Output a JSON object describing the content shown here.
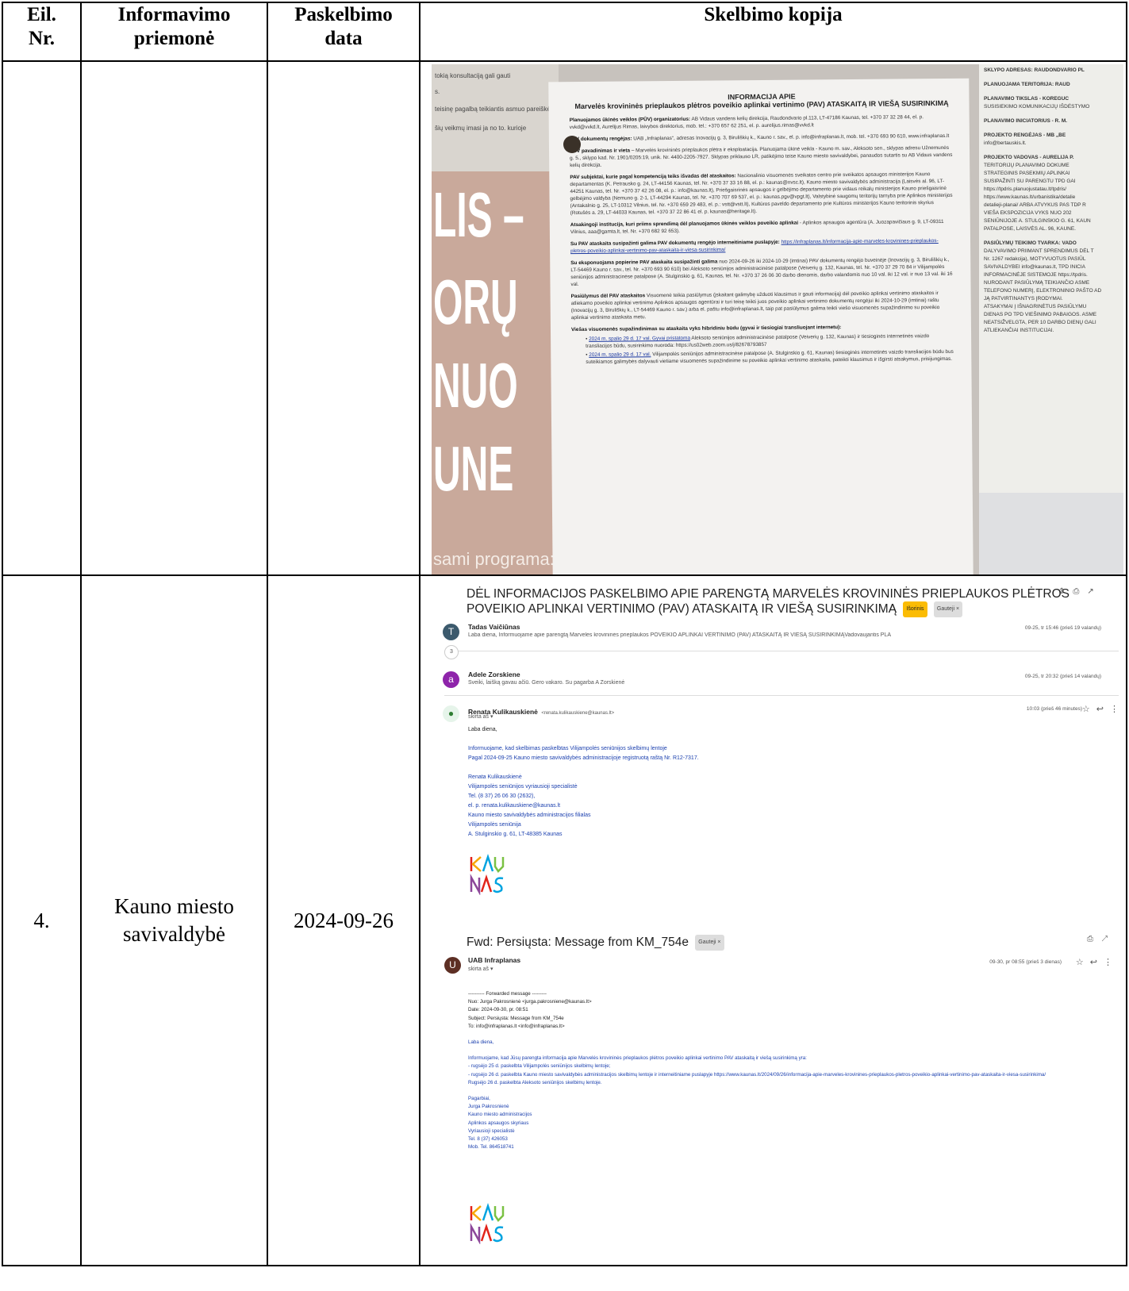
{
  "table": {
    "headers": {
      "col1": [
        "Eil.",
        "Nr."
      ],
      "col2": [
        "Informavimo",
        "priemonė"
      ],
      "col3": [
        "Paskelbimo",
        "data"
      ],
      "col4": "Skelbimo kopija"
    },
    "row2": {
      "nr": "4.",
      "medium": [
        "Kauno miesto",
        "savivaldybė"
      ],
      "date": "2024-09-26"
    }
  },
  "photo": {
    "left_lines": [
      "tokią konsultaciją gali gauti",
      "s.",
      "teisinę pagalbą teikiantis asmuo pareiškėj",
      "šių veikmų imasi ja no to. kurioje"
    ],
    "big": [
      "LIS –",
      "ORŲ",
      "NUO",
      "UNE"
    ],
    "bottom_word": "sami programa:",
    "title1": "INFORMACIJA APIE",
    "title2": "Marvelės krovininės prieplaukos plėtros poveikio aplinkai vertinimo (PAV) ATASKAITĄ IR VIEŠĄ SUSIRINKIMĄ",
    "p1_label": "Planuojamos ūkinės veiklos (PŪV) organizatorius:",
    "p1": " AB Vidaus vandens kelių direkcija, Raudondvario pl.113, LT-47186 Kaunas, tel. +370 37 32 28 44, el. p. vvkd@vvkd.lt, Aurelijus Rimas, laivybos direktorius, mob. tel.: +370 657 62 251, el. p. aurelijus.rimas@vvkd.lt",
    "p2_label": "PAV dokumentų rengėjas:",
    "p2": " UAB „Infraplanas“, adresas Inovacijų g. 3, Biruliškių k., Kauno r. sav., el. p. info@infraplanas.lt, mob. tel. +370 693 90 610, www.infraplanas.lt",
    "p3_label": "PŪV pavadinimas ir vieta",
    "p3": " – Marvelės krovininės prieplaukos plėtra ir eksploatacija. Planuojama ūkinė veikla - Kauno m. sav., Aleksoto sen., sklypas adresu Užnemunės g. 5., sklypo kad. Nr. 1901/0205:19, unik. Nr. 4400-2205-7927. Sklypas priklauso LR, patikėjimo teise Kauno miesto savivaldybei, panaudos sutartis su AB Vidaus vandens kelių direkcija.",
    "p4_label": "PAV subjektai, kurie pagal kompetenciją teiks išvadas dėl ataskaitos:",
    "p4": " Nacionalinio visuomenės sveikatos centro prie sveikatos apsaugos ministerijos Kauno departamentas (K. Petrausko g. 24, LT-44156 Kaunas, tel. Nr. +370 37 33 16 88, el. p.: kaunas@nvsc.lt), Kauno miesto savivaldybės administracija (Laisvės al. 96, LT-44251 Kaunas, tel. Nr. +370 37 42 26 08, el. p.: info@kaunas.lt), Priešgaisrinės apsaugos ir gelbėjimo departamento prie vidaus reikalų ministerijos Kauno priešgaisrinė gelbėjimo valdyba (Nemuno g. 2-1, LT-44294 Kaunas, tel. Nr. +370 707 69 537, el. p.: kaunas.pgv@vpgt.lt), Valstybinė saugomų teritorijų tarnyba prie Aplinkos ministerijos (Antakalnio g. 25, LT-10312 Vilnius, tel. Nr. +370 659 29 483, el. p.: vstt@vstt.lt), Kultūros paveldo departamento prie Kultūros ministerijos Kauno teritorinis skyrius (Rotušės a. 29, LT-44033 Kaunas, tel. +370 37 22 86 41 el. p. kaunas@heritage.lt).",
    "p5_label": "Atsakingoji institucija, kuri priims sprendimą dėl planuojamos ūkinės veiklos poveikio aplinkai",
    "p5": " - Aplinkos apsaugos agentūra (A. Juozapavičiaus g. 9, LT-09311 Vilnius, aaa@gamta.lt, tel. Nr. +370 682 92 653).",
    "p6_label": "Su PAV ataskaita susipažinti galima PAV dokumentų rengėjo interneitiniame puslapyje:",
    "p6_link": "https://infraplanas.lt/informacija-apie-marveles-krovinines-prieplaukos-pletros-poveikio-aplinkai-vertinimo-pav-ataskaita-ir-viesa-susirinkima/",
    "p7_label": "Su eksponuojama popierine PAV ataskaita susipažinti galima",
    "p7": " nuo 2024-09-26 iki 2024-10-29 (imtinai) PAV dokumentų rengėjo buveinėje (Inovacijų g. 3, Biruliškių k., LT-54469 Kauno r. sav., tel. Nr. +370 693 90 610) bei Aleksoto seniūnijos administracinėse patalpose (Veiverių g. 132, Kaunas, tel. Nr. +370 37 29 70 84 ir Vilijampolės seniūnijos administracinėse patalpose (A. Stulginskio g. 61, Kaunas, tel. Nr. +370 37 26 06 30 darbo dienomis, darbo valandomis nuo 10 val. iki 12 val. ir nuo 13 val. iki 16 val.",
    "p8_label": "Pasiūlymus dėl PAV ataskaitos",
    "p8": " Visuomenė teikia pasiūlymus (įskaitant galimybę užduoti klausimus ir gauti informaciją) dėl poveikio aplinkai vertinimo ataskaitos ir atliekamo poveikio aplinkai vertinimo Aplinkos apsaugos agentūrai ir turi teisę teikti juos poveikio aplinkai vertinimo dokumentų rengėjui iki 2024-10-29 (imtinai) raštu (Inovacijų g. 3, Biruliškių k., LT-54469 Kauno r. sav.) arba el. paštu info@infraplanas.lt, taip pat pasiūlymus galima teikti viešo visuomenės supažindinimo su poveikio aplinkai vertinimo ataskaita metu.",
    "p9_label": "Viešas visuomenės supažindinimas su ataskaita vyks hibridiniu būdu (gyvai ir tiesiogiai transliuojant internetu):",
    "b1_date": "2024 m. spalio 29 d. 17 val. Gyvai pristatoma",
    "b1": " Aleksoto seniūnijos administracinėse patalpose (Veiverių g. 132, Kaunas) ir tiesioginės internetinės vaizdo transliacijos būdu, susirinkimo nuoroda: https://us02web.zoom.us/j/82678793857",
    "b2_date": "2024 m. spalio 29 d. 17 val.",
    "b2": " Vilijampolės seniūnijos administracinėse patalpose (A. Stulginskio g. 61, Kaunas) tiesioginės internetinės vaizdo transliacijos būdu bus suteikiamos galimybės dalyvauti vietiame visuomenės supažindinime su poveikio aplinkai vertinimo ataskaita, pateikti klausimus ir išgirsti atsakymus, prisijungimas.",
    "right": [
      "SKLYPO ADRESAS: RAUDONDVARIO PL",
      "PLANUOJAMA TERITORIJA: RAUD",
      "PLANAVIMO TIKSLAS - KOREGUC",
      "SUSISIEKIMO KOMUNIKACIJŲ IŠDĖSTYMO",
      "PLANAVIMO INICIATORIUS - R. M.",
      "PROJEKTO RENGĖJAS - MB „BE",
      "info@bertauskis.lt.",
      "PROJEKTO VADOVAS - AURELIJA P.",
      "TERITORIJŲ PLANAVIMO DOKUME",
      "STRATEGINIS PASEKMIŲ APLINKAI",
      "SUSIPAŽINTI SU PARENGTU TPD GAI",
      "https://tpdris.planuojustatau.lt/tpdris/",
      "https://www.kaunas.lt/urbanistika/detalie",
      "detalieji-planai/ ARBA ATVYKUS PAS TDP R",
      "VIEŠA EKSPOZICIJA VYKS NUO 202",
      "SENIŪNIJOJE A. STULGINSKIO G. 61, KAUN",
      "PATALPOSE, LAISVĖS AL. 96, KAUNE.",
      "PASIŪLYMŲ TEIKIMO TVARKA: VADO",
      "DALYVAVIMO PRIIMANT SPRENDIMUS DĖL T",
      "Nr. 1267 redakcija), MOTYVUOTUS PASIŪL",
      "SAVIVALDYBEI info@kaunas.lt, TPD INICIA",
      "INFORMACINĖJE SISTEMOJE https://tpdris.",
      "NURODANT PASIŪLYMĄ TEIKIANČIO ASME",
      "TELEFONO NUMERĮ, ELEKTRONINIO PAŠTO AD",
      "JĄ PATVIRTINANTYS ĮRODYMAI.",
      "ATSAKYMAI Į IŠNAGRINĖTUS PASIŪLYMU",
      "DIENAS PO TPD VIEŠINIMO PABAIGOS. ASME",
      "NEATSIŽVELGTA, PER 10 DARBO DIENŲ GALI",
      "ATLIEKANČIAI INSTITUCIJAI."
    ]
  },
  "email1": {
    "subject": "DĖL INFORMACIJOS PASKELBIMO APIE PARENGTĄ MARVELĖS KROVININĖS PRIEPLAUKOS PLĖTROS POVEIKIO APLINKAI VERTINIMO (PAV) ATASKAITĄ IR VIEŠĄ SUSIRINKIMĄ",
    "tag1": "Išorinis",
    "tag2": "Gauteji ×",
    "m1_initial": "T",
    "m1_name": "Tadas Vaičiūnas",
    "m1_snippet": "Laba diena, Informuojame apie parengtą Marvelės krovininės prieplaukos POVEIKIO APLINKAI VERTINIMO (PAV) ATASKAITĄ IR VIEŠĄ SUSIRINKIMĄVadovaujantis PLA",
    "m1_date": "09-25, tr 15:46 (prieš 19 valandų)",
    "collapsed": "3",
    "m2_initial": "a",
    "m2_name": "Adele Zorskiene",
    "m2_snippet": "Sveiki, laišką gavau ačiū. Gero vakaro. Su pagarba A Zorskienė",
    "m2_date": "09-25, tr 20:32 (prieš 14 valandų)",
    "m3_name": "Renata Kulikauskienė",
    "m3_email": "<renata.kulikauskiene@kaunas.lt>",
    "m3_to": "skirta aš ▾",
    "m3_date": "10:03 (prieš 46 minutes)",
    "body": [
      "Laba diena,",
      "",
      "Informuojame, kad skelbimas paskelbtas Vilijampolės seniūnijos skelbimų lentoje",
      "Pagal 2024-09-25 Kauno miesto savivaldybės administracijoje registruotą raštą Nr. R12-7317.",
      "",
      "Renata Kulikauskienė",
      "Vilijampolės seniūnijos vyriausioji specialistė",
      "Tel. (8 37) 26 06 30 (2632),",
      "el. p. renata.kulikauskiene@kaunas.lt",
      "Kauno miesto savivaldybės administracijos filialas",
      "Vilijampolės seniūnija",
      "A. Stulginskio g. 61, LT-48385 Kaunas"
    ]
  },
  "email2": {
    "subject": "Fwd: Persiųsta: Message from KM_754e",
    "tag": "Gauteji ×",
    "initial": "U",
    "name": "UAB Infraplanas",
    "to": "skirta aš ▾",
    "date": "09-30, pr 08:55 (prieš 3 dienas)",
    "body": [
      "---------- Forwarded message ---------",
      "Nuo: Jurga Pakrosnienė <jurga.pakrosniene@kaunas.lt>",
      "Date: 2024-09-30, pr. 08:51",
      "Subject: Persiųsta: Message from KM_754e",
      "To: info@infraplanas.lt <info@infraplanas.lt>",
      "",
      "Laba diena,",
      "",
      "Informuojame, kad Jūsų parengta informacija apie Marvelės krovininės prieplaukos plėtros poveikio aplinkai vertinimo PAV ataskaitą ir viešą susirinkimą yra:",
      "- rugsėjo 25 d. paskelbta Vilijampolės seniūnijos skelbimų lentoje;",
      "- rugsėjo 26 d. paskelbta Kauno miesto savivaldybės administracijos skelbimų lentoje ir interneitiniame puslapyje https://www.kaunas.lt/2024/09/26/informacija-apie-marveles-krovinines-prieplaukos-pletros-poveikio-aplinkai-vertinimo-pav-ataskaita-ir-viesa-susirinkima/",
      "Rugsėjo 26 d. paskelbta Aleksoto seniūnijos skelbimų lentoje.",
      "",
      "Pagarbiai,",
      "Jurga Pakrosnienė",
      "Kauno miesto administracijos",
      "Aplinkos apsaugos skyriaus",
      "Vyriausioji specialistė",
      "Tel. 8 (37) 426053",
      "Mob. Tel. 864518741"
    ]
  },
  "logo": {
    "top": "KAU",
    "bottom": "NAS",
    "colors": [
      "#e2231a",
      "#f7a600",
      "#00a3e0",
      "#7ac143",
      "#8c4799"
    ]
  }
}
